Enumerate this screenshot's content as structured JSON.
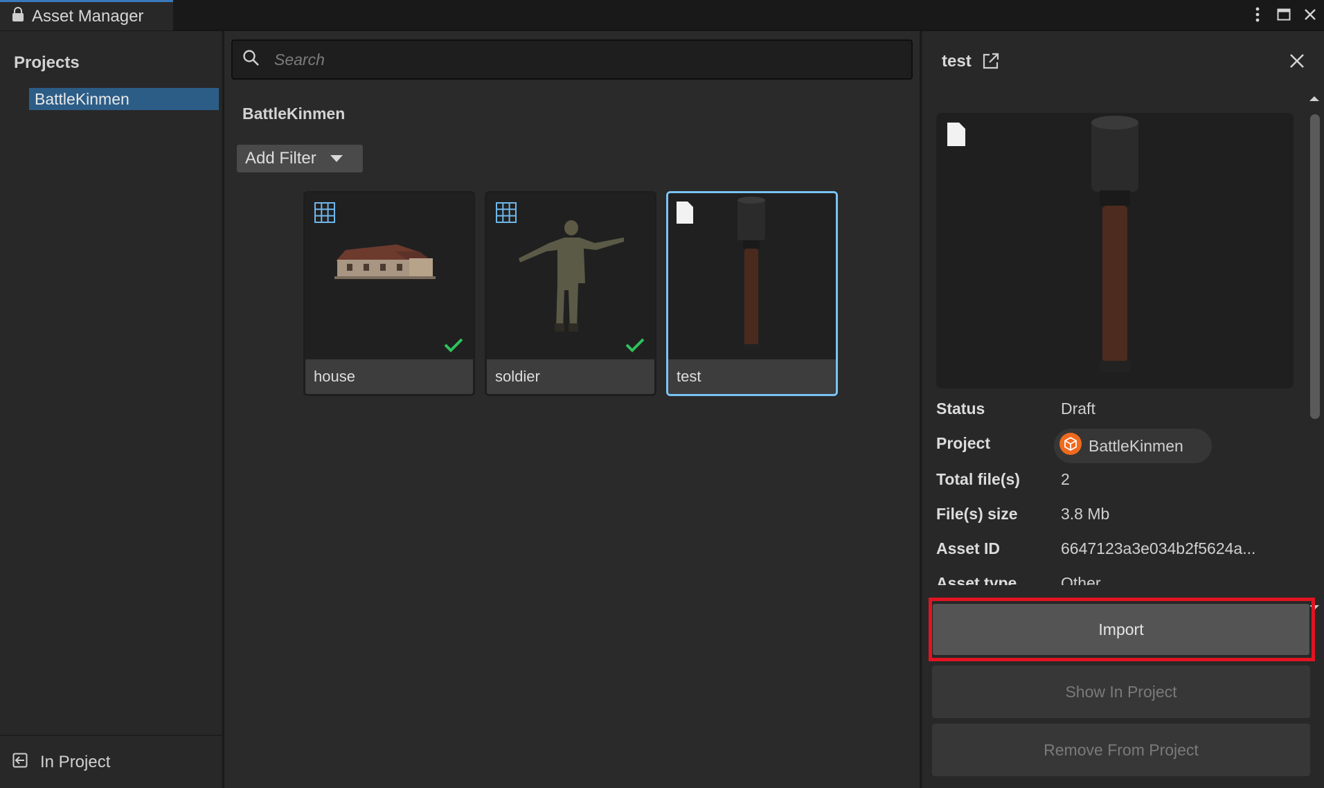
{
  "window": {
    "title": "Asset Manager",
    "controls": [
      "more-icon",
      "maximize-icon",
      "close-icon"
    ]
  },
  "sidebar": {
    "heading": "Projects",
    "items": [
      {
        "label": "BattleKinmen",
        "selected": true
      }
    ],
    "footer_label": "In Project"
  },
  "browser": {
    "search_placeholder": "Search",
    "breadcrumb": "BattleKinmen",
    "filter_label": "Add Filter",
    "assets": [
      {
        "name": "house",
        "type_icon": "grid-icon",
        "imported": true,
        "selected": false
      },
      {
        "name": "soldier",
        "type_icon": "grid-icon",
        "imported": true,
        "selected": false
      },
      {
        "name": "test",
        "type_icon": "file-icon",
        "imported": false,
        "selected": true
      }
    ]
  },
  "details": {
    "title": "test",
    "fields": {
      "status_label": "Status",
      "status_value": "Draft",
      "project_label": "Project",
      "project_value": "BattleKinmen",
      "total_files_label": "Total file(s)",
      "total_files_value": "2",
      "files_size_label": "File(s) size",
      "files_size_value": "3.8 Mb",
      "asset_id_label": "Asset ID",
      "asset_id_value": "6647123a3e034b2f5624a...",
      "asset_type_label": "Asset type",
      "asset_type_value": "Other"
    },
    "buttons": {
      "import": "Import",
      "show_in_project": "Show In Project",
      "remove_from_project": "Remove From Project"
    }
  },
  "colors": {
    "selection": "#2c5d87",
    "selected_card_border": "#7ac4f5",
    "check": "#2fc25b",
    "highlight": "#e11422",
    "project_badge": "#f06a1e"
  }
}
